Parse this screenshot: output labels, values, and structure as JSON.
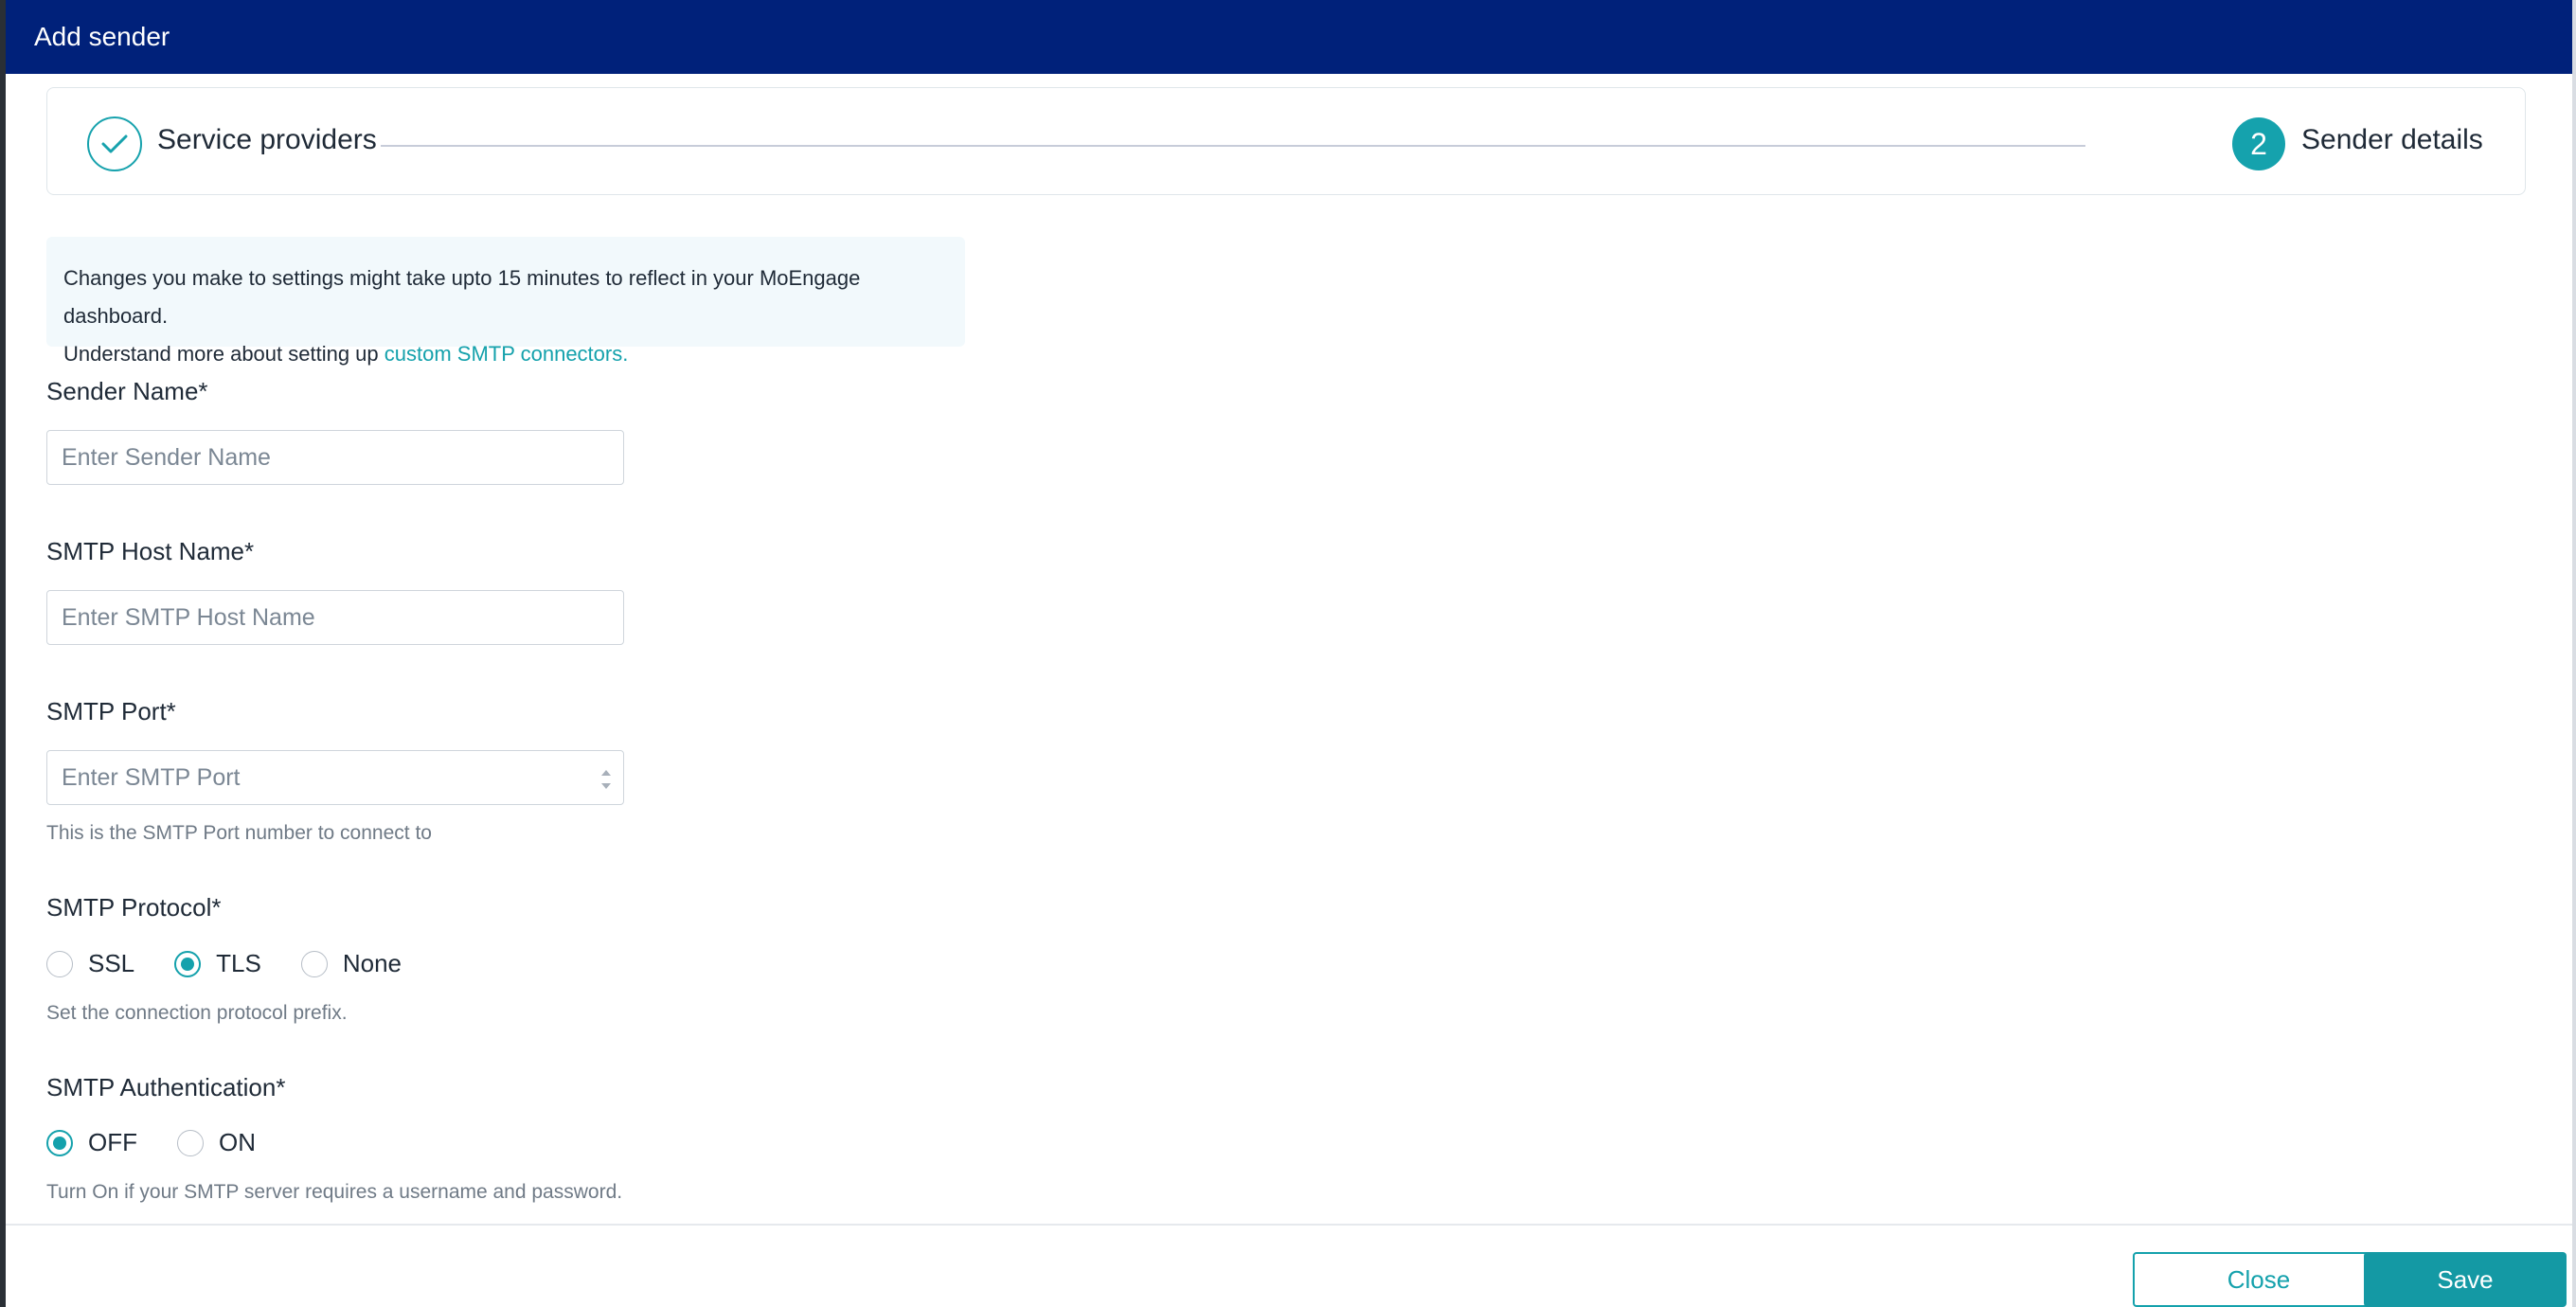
{
  "dialog": {
    "title": "Add sender"
  },
  "stepper": {
    "step1": {
      "label": "Service providers",
      "icon": "check-icon"
    },
    "step2": {
      "number": "2",
      "label": "Sender details"
    }
  },
  "info": {
    "line1": "Changes you make to settings might take upto 15 minutes to reflect in your MoEngage dashboard.",
    "line2_prefix": "Understand more about setting up ",
    "link": "custom SMTP connectors."
  },
  "form": {
    "sender_name": {
      "label": "Sender Name*",
      "placeholder": "Enter Sender Name"
    },
    "smtp_host": {
      "label": "SMTP Host Name*",
      "placeholder": "Enter SMTP Host Name"
    },
    "smtp_port": {
      "label": "SMTP Port*",
      "placeholder": "Enter SMTP Port",
      "hint": "This is the SMTP Port number to connect to"
    },
    "smtp_protocol": {
      "label": "SMTP Protocol*",
      "options": [
        "SSL",
        "TLS",
        "None"
      ],
      "selected": "TLS",
      "hint": "Set the connection protocol prefix."
    },
    "smtp_auth": {
      "label": "SMTP Authentication*",
      "options": [
        "OFF",
        "ON"
      ],
      "selected": "OFF",
      "hint": "Turn On if your SMTP server requires a username and password."
    }
  },
  "footer": {
    "close": "Close",
    "save": "Save"
  },
  "colors": {
    "header": "#00217a",
    "accent": "#14a1ac"
  }
}
